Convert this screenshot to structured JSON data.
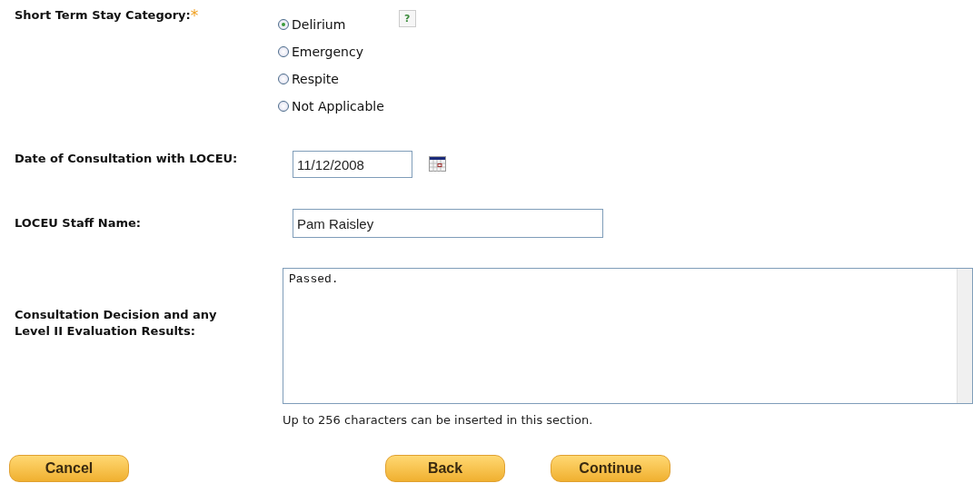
{
  "category": {
    "label": "Short Term Stay Category:",
    "required_mark": "*",
    "help": "?",
    "options": [
      {
        "label": "Delirium",
        "selected": true
      },
      {
        "label": "Emergency",
        "selected": false
      },
      {
        "label": "Respite",
        "selected": false
      },
      {
        "label": "Not Applicable",
        "selected": false
      }
    ]
  },
  "consultation_date": {
    "label": "Date of Consultation with LOCEU:",
    "value": "11/12/2008"
  },
  "staff_name": {
    "label": "LOCEU Staff Name:",
    "value": "Pam Raisley"
  },
  "decision": {
    "label": "Consultation Decision and any Level II Evaluation Results:",
    "value": "Passed.",
    "hint": "Up to 256 characters can be inserted in this section."
  },
  "buttons": [
    {
      "label": "Cancel"
    },
    {
      "label": "Back"
    },
    {
      "label": "Continue"
    }
  ]
}
